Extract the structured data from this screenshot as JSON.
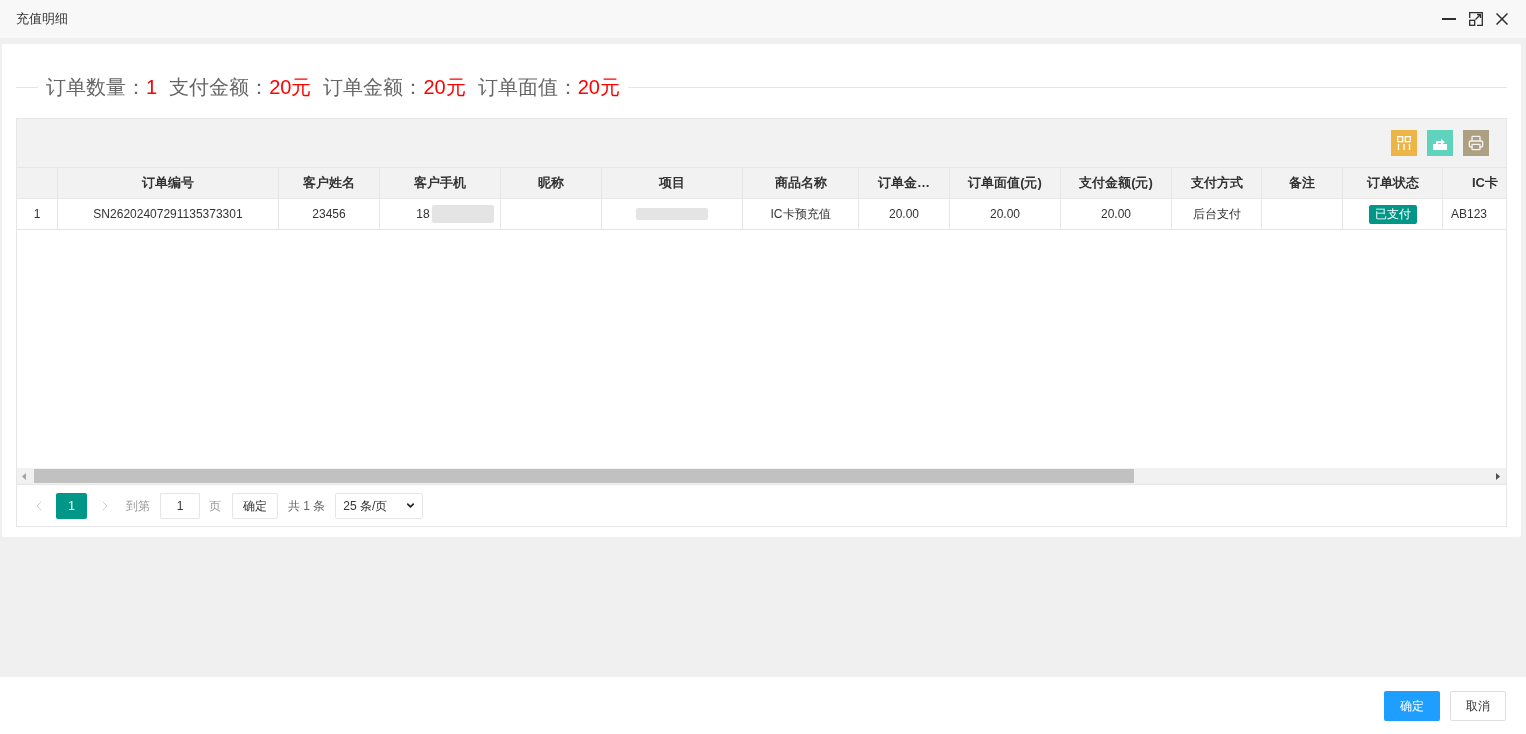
{
  "window": {
    "title": "充值明细"
  },
  "summary": [
    {
      "label": "订单数量：",
      "value": "1"
    },
    {
      "label": "支付金额：",
      "value": "20元"
    },
    {
      "label": "订单金额：",
      "value": "20元"
    },
    {
      "label": "订单面值：",
      "value": "20元"
    }
  ],
  "toolbar": [
    {
      "kind": "columns",
      "color": "#edb446"
    },
    {
      "kind": "export",
      "color": "#5fd3bb"
    },
    {
      "kind": "print",
      "color": "#ad9f81"
    }
  ],
  "table": {
    "columns": [
      "订单编号",
      "客户姓名",
      "客户手机",
      "昵称",
      "项目",
      "商品名称",
      "订单金…",
      "订单面值(元)",
      "支付金额(元)",
      "支付方式",
      "备注",
      "订单状态",
      "IC卡"
    ],
    "rows": [
      {
        "index": "1",
        "cells": [
          {
            "kind": "text",
            "text": "SN26202407291135373301"
          },
          {
            "kind": "text",
            "text": "23456"
          },
          {
            "kind": "redacted",
            "text": "18"
          },
          {
            "kind": "blank"
          },
          {
            "kind": "redacted"
          },
          {
            "kind": "text",
            "text": "IC卡预充值"
          },
          {
            "kind": "text",
            "text": "20.00"
          },
          {
            "kind": "text",
            "text": "20.00"
          },
          {
            "kind": "text",
            "text": "20.00"
          },
          {
            "kind": "text",
            "text": "后台支付"
          },
          {
            "kind": "blank"
          },
          {
            "kind": "badge",
            "text": "已支付"
          },
          {
            "kind": "text",
            "text": "AB123"
          }
        ]
      }
    ]
  },
  "pager": {
    "prev": {
      "disabled": true
    },
    "pages": [
      {
        "label": "1",
        "selected": true
      }
    ],
    "next": {
      "disabled": true
    },
    "goto_label": "到第",
    "page_input": "1",
    "page_unit": "页",
    "go_button": "确定",
    "total": "共 1 条",
    "page_size": "25 条/页"
  },
  "footer": {
    "buttons": [
      {
        "kind": "primary",
        "label": "确定"
      },
      {
        "kind": "default",
        "label": "取消"
      }
    ]
  }
}
